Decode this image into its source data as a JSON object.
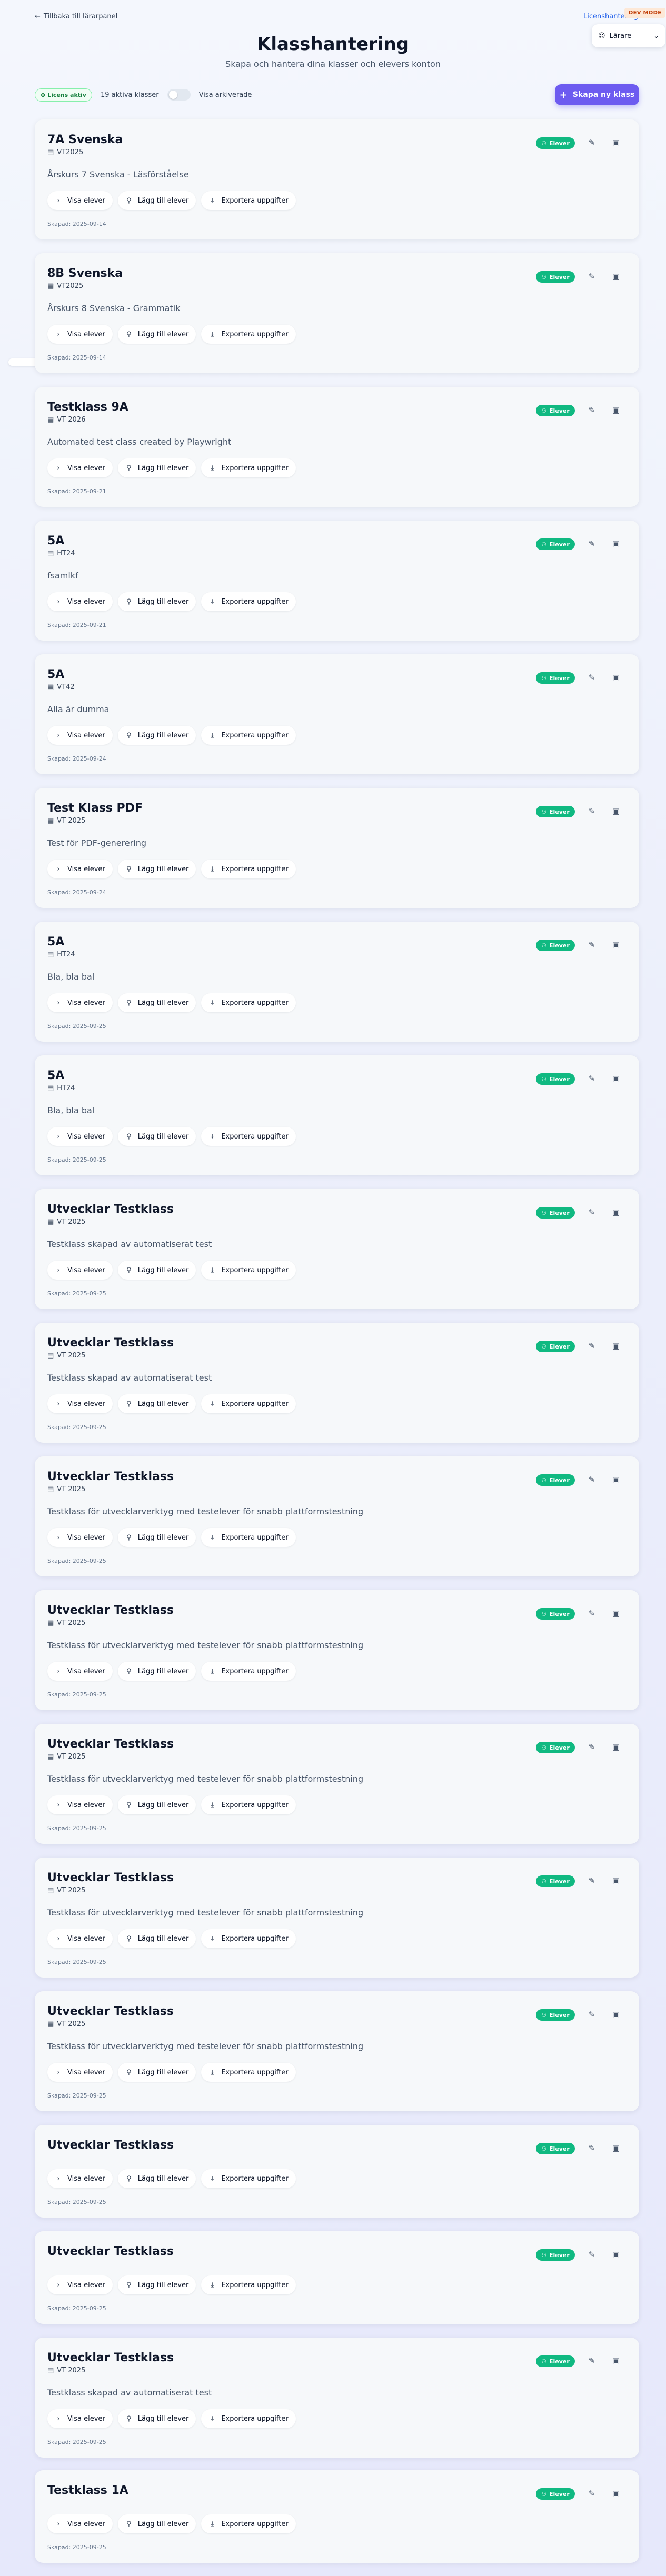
{
  "header": {
    "back_link": "Tillbaka till lärarpanel",
    "license_link": "Licenshantering",
    "dev_badge": "DEV MODE",
    "role_selector": "Lärare",
    "title": "Klasshantering",
    "subtitle": "Skapa och hantera dina klasser och elevers konton"
  },
  "toolbar": {
    "license_badge": "Licens aktiv",
    "active_count": "19 aktiva klasser",
    "show_archived_label": "Visa arkiverade",
    "create_button": "Skapa ny klass"
  },
  "labels": {
    "students_badge": "Elever",
    "view_students": "Visa elever",
    "add_students": "Lägg till elever",
    "export_assignments": "Exportera uppgifter"
  },
  "classes": [
    {
      "name": "7A Svenska",
      "term": "VT2025",
      "description": "Årskurs 7 Svenska - Läsförståelse",
      "created": "Skapad: 2025-09-14"
    },
    {
      "name": "8B Svenska",
      "term": "VT2025",
      "description": "Årskurs 8 Svenska - Grammatik",
      "created": "Skapad: 2025-09-14"
    },
    {
      "name": "Testklass 9A",
      "term": "VT 2026",
      "description": "Automated test class created by Playwright",
      "created": "Skapad: 2025-09-21"
    },
    {
      "name": "5A",
      "term": "HT24",
      "description": "fsamlkf",
      "created": "Skapad: 2025-09-21"
    },
    {
      "name": "5A",
      "term": "VT42",
      "description": "Alla är dumma",
      "created": "Skapad: 2025-09-24"
    },
    {
      "name": "Test Klass PDF",
      "term": "VT 2025",
      "description": "Test för PDF-generering",
      "created": "Skapad: 2025-09-24"
    },
    {
      "name": "5A",
      "term": "HT24",
      "description": "Bla, bla bal",
      "created": "Skapad: 2025-09-25"
    },
    {
      "name": "5A",
      "term": "HT24",
      "description": "Bla, bla bal",
      "created": "Skapad: 2025-09-25"
    },
    {
      "name": "Utvecklar Testklass",
      "term": "VT 2025",
      "description": "Testklass skapad av automatiserat test",
      "created": "Skapad: 2025-09-25"
    },
    {
      "name": "Utvecklar Testklass",
      "term": "VT 2025",
      "description": "Testklass skapad av automatiserat test",
      "created": "Skapad: 2025-09-25"
    },
    {
      "name": "Utvecklar Testklass",
      "term": "VT 2025",
      "description": "Testklass för utvecklarverktyg med testelever för snabb plattformstestning",
      "created": "Skapad: 2025-09-25"
    },
    {
      "name": "Utvecklar Testklass",
      "term": "VT 2025",
      "description": "Testklass för utvecklarverktyg med testelever för snabb plattformstestning",
      "created": "Skapad: 2025-09-25"
    },
    {
      "name": "Utvecklar Testklass",
      "term": "VT 2025",
      "description": "Testklass för utvecklarverktyg med testelever för snabb plattformstestning",
      "created": "Skapad: 2025-09-25"
    },
    {
      "name": "Utvecklar Testklass",
      "term": "VT 2025",
      "description": "Testklass för utvecklarverktyg med testelever för snabb plattformstestning",
      "created": "Skapad: 2025-09-25"
    },
    {
      "name": "Utvecklar Testklass",
      "term": "VT 2025",
      "description": "Testklass för utvecklarverktyg med testelever för snabb plattformstestning",
      "created": "Skapad: 2025-09-25"
    },
    {
      "name": "Utvecklar Testklass",
      "term": "",
      "description": "",
      "created": "Skapad: 2025-09-25"
    },
    {
      "name": "Utvecklar Testklass",
      "term": "",
      "description": "",
      "created": "Skapad: 2025-09-25"
    },
    {
      "name": "Utvecklar Testklass",
      "term": "VT 2025",
      "description": "Testklass skapad av automatiserat test",
      "created": "Skapad: 2025-09-25"
    },
    {
      "name": "Testklass 1A",
      "term": "",
      "description": "",
      "created": "Skapad: 2025-09-25"
    }
  ],
  "colors": {
    "accent": "#6d5bf0",
    "students_badge": "#10b981",
    "license_link": "#2563eb",
    "dev_badge_text": "#c2410c"
  },
  "icons": {
    "back": "arrow-left-icon",
    "role": "user-icon",
    "create": "plus-icon",
    "term": "calendar-icon",
    "edit": "pencil-icon",
    "archive": "archive-icon",
    "students": "users-icon",
    "view": "chevron-right-icon",
    "add": "user-plus-icon",
    "export": "download-icon"
  }
}
